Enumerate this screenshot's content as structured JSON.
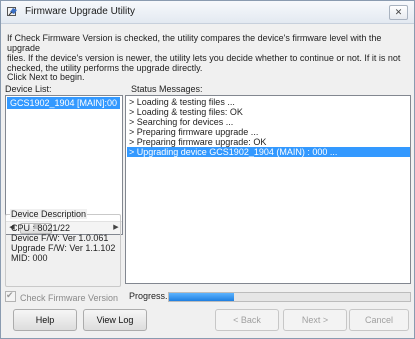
{
  "window": {
    "title": "Firmware Upgrade Utility",
    "close_glyph": "✕",
    "icon": "firmware-app-icon"
  },
  "intro": {
    "lines": [
      "If Check Firmware Version is checked, the utility compares the device's firmware level with the upgrade",
      "files. If the device's version is newer, the utility lets you decide whether to continue or not. If it is not",
      "checked, the utility performs the upgrade directly."
    ],
    "click_next": "Click Next to begin."
  },
  "device_list": {
    "label": "Device List:",
    "items": [
      "GCS1902_1904 [MAIN]:00"
    ],
    "scroll_thumb": "III"
  },
  "device_description": {
    "legend": "Device Description",
    "lines": [
      "CPU : 8021/22",
      "Device F/W: Ver 1.0.061",
      "Upgrade F/W: Ver 1.1.102",
      "MID: 000"
    ]
  },
  "status": {
    "label": "Status Messages:",
    "messages": [
      "> Loading & testing files ...",
      "> Loading & testing files: OK",
      "> Searching for devices ...",
      "> Preparing firmware upgrade ...",
      "> Preparing firmware upgrade: OK",
      "> Upgrading device GCS1902_1904 (MAIN) : 000 ..."
    ],
    "selected_index": 5
  },
  "footer": {
    "check_firmware_label": "Check Firmware Version",
    "check_firmware_checked": true,
    "progress_label": "Progress...",
    "progress_fraction": 0.27
  },
  "buttons": {
    "help": "Help",
    "view_log": "View Log",
    "back": "< Back",
    "next": "Next >",
    "cancel": "Cancel"
  },
  "colors": {
    "selection": "#3399ff",
    "progress": "#1f7fe0"
  }
}
